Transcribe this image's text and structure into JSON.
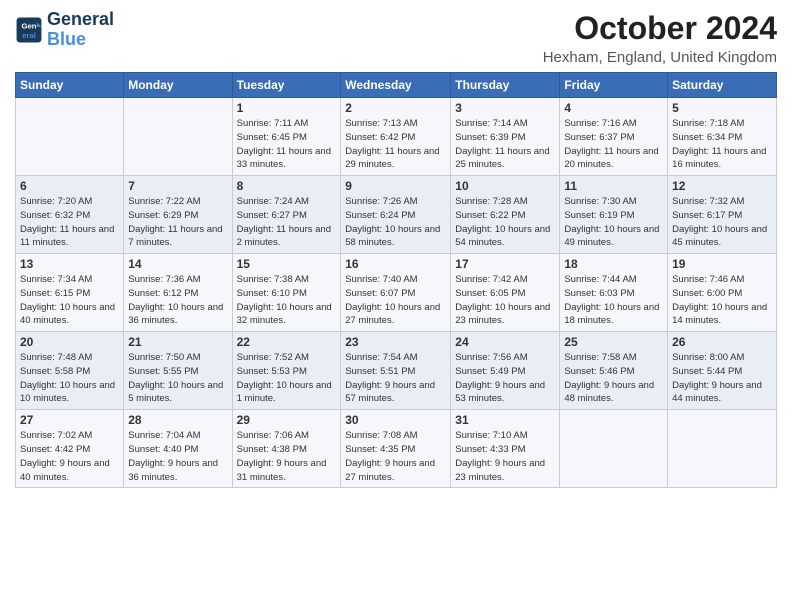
{
  "logo": {
    "line1": "General",
    "line2": "Blue"
  },
  "title": "October 2024",
  "location": "Hexham, England, United Kingdom",
  "days_of_week": [
    "Sunday",
    "Monday",
    "Tuesday",
    "Wednesday",
    "Thursday",
    "Friday",
    "Saturday"
  ],
  "weeks": [
    [
      {
        "day": "",
        "info": ""
      },
      {
        "day": "",
        "info": ""
      },
      {
        "day": "1",
        "info": "Sunrise: 7:11 AM\nSunset: 6:45 PM\nDaylight: 11 hours and 33 minutes."
      },
      {
        "day": "2",
        "info": "Sunrise: 7:13 AM\nSunset: 6:42 PM\nDaylight: 11 hours and 29 minutes."
      },
      {
        "day": "3",
        "info": "Sunrise: 7:14 AM\nSunset: 6:39 PM\nDaylight: 11 hours and 25 minutes."
      },
      {
        "day": "4",
        "info": "Sunrise: 7:16 AM\nSunset: 6:37 PM\nDaylight: 11 hours and 20 minutes."
      },
      {
        "day": "5",
        "info": "Sunrise: 7:18 AM\nSunset: 6:34 PM\nDaylight: 11 hours and 16 minutes."
      }
    ],
    [
      {
        "day": "6",
        "info": "Sunrise: 7:20 AM\nSunset: 6:32 PM\nDaylight: 11 hours and 11 minutes."
      },
      {
        "day": "7",
        "info": "Sunrise: 7:22 AM\nSunset: 6:29 PM\nDaylight: 11 hours and 7 minutes."
      },
      {
        "day": "8",
        "info": "Sunrise: 7:24 AM\nSunset: 6:27 PM\nDaylight: 11 hours and 2 minutes."
      },
      {
        "day": "9",
        "info": "Sunrise: 7:26 AM\nSunset: 6:24 PM\nDaylight: 10 hours and 58 minutes."
      },
      {
        "day": "10",
        "info": "Sunrise: 7:28 AM\nSunset: 6:22 PM\nDaylight: 10 hours and 54 minutes."
      },
      {
        "day": "11",
        "info": "Sunrise: 7:30 AM\nSunset: 6:19 PM\nDaylight: 10 hours and 49 minutes."
      },
      {
        "day": "12",
        "info": "Sunrise: 7:32 AM\nSunset: 6:17 PM\nDaylight: 10 hours and 45 minutes."
      }
    ],
    [
      {
        "day": "13",
        "info": "Sunrise: 7:34 AM\nSunset: 6:15 PM\nDaylight: 10 hours and 40 minutes."
      },
      {
        "day": "14",
        "info": "Sunrise: 7:36 AM\nSunset: 6:12 PM\nDaylight: 10 hours and 36 minutes."
      },
      {
        "day": "15",
        "info": "Sunrise: 7:38 AM\nSunset: 6:10 PM\nDaylight: 10 hours and 32 minutes."
      },
      {
        "day": "16",
        "info": "Sunrise: 7:40 AM\nSunset: 6:07 PM\nDaylight: 10 hours and 27 minutes."
      },
      {
        "day": "17",
        "info": "Sunrise: 7:42 AM\nSunset: 6:05 PM\nDaylight: 10 hours and 23 minutes."
      },
      {
        "day": "18",
        "info": "Sunrise: 7:44 AM\nSunset: 6:03 PM\nDaylight: 10 hours and 18 minutes."
      },
      {
        "day": "19",
        "info": "Sunrise: 7:46 AM\nSunset: 6:00 PM\nDaylight: 10 hours and 14 minutes."
      }
    ],
    [
      {
        "day": "20",
        "info": "Sunrise: 7:48 AM\nSunset: 5:58 PM\nDaylight: 10 hours and 10 minutes."
      },
      {
        "day": "21",
        "info": "Sunrise: 7:50 AM\nSunset: 5:55 PM\nDaylight: 10 hours and 5 minutes."
      },
      {
        "day": "22",
        "info": "Sunrise: 7:52 AM\nSunset: 5:53 PM\nDaylight: 10 hours and 1 minute."
      },
      {
        "day": "23",
        "info": "Sunrise: 7:54 AM\nSunset: 5:51 PM\nDaylight: 9 hours and 57 minutes."
      },
      {
        "day": "24",
        "info": "Sunrise: 7:56 AM\nSunset: 5:49 PM\nDaylight: 9 hours and 53 minutes."
      },
      {
        "day": "25",
        "info": "Sunrise: 7:58 AM\nSunset: 5:46 PM\nDaylight: 9 hours and 48 minutes."
      },
      {
        "day": "26",
        "info": "Sunrise: 8:00 AM\nSunset: 5:44 PM\nDaylight: 9 hours and 44 minutes."
      }
    ],
    [
      {
        "day": "27",
        "info": "Sunrise: 7:02 AM\nSunset: 4:42 PM\nDaylight: 9 hours and 40 minutes."
      },
      {
        "day": "28",
        "info": "Sunrise: 7:04 AM\nSunset: 4:40 PM\nDaylight: 9 hours and 36 minutes."
      },
      {
        "day": "29",
        "info": "Sunrise: 7:06 AM\nSunset: 4:38 PM\nDaylight: 9 hours and 31 minutes."
      },
      {
        "day": "30",
        "info": "Sunrise: 7:08 AM\nSunset: 4:35 PM\nDaylight: 9 hours and 27 minutes."
      },
      {
        "day": "31",
        "info": "Sunrise: 7:10 AM\nSunset: 4:33 PM\nDaylight: 9 hours and 23 minutes."
      },
      {
        "day": "",
        "info": ""
      },
      {
        "day": "",
        "info": ""
      }
    ]
  ]
}
